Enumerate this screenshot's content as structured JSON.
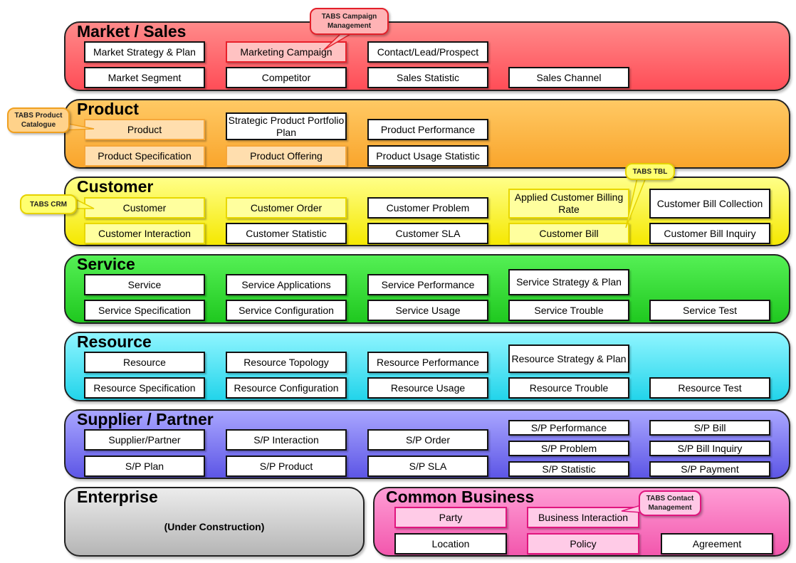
{
  "colors": {
    "market_sales": "#ff5b63",
    "product": "#fbb040",
    "customer": "#f8ef20",
    "service": "#2ed82e",
    "resource": "#3ddcef",
    "supplier_partner": "#736dee",
    "enterprise": "#cfcfcf",
    "common_business": "#f773bd"
  },
  "bands": {
    "market_sales": {
      "title": "Market / Sales",
      "entities": [
        "Market Strategy & Plan",
        "Marketing Campaign",
        "Contact/Lead/Prospect",
        "Market Segment",
        "Competitor",
        "Sales Statistic",
        "Sales Channel"
      ]
    },
    "product": {
      "title": "Product",
      "entities": [
        "Product",
        "Strategic Product Portfolio Plan",
        "Product Performance",
        "Product Specification",
        "Product Offering",
        "Product Usage Statistic"
      ]
    },
    "customer": {
      "title": "Customer",
      "entities": [
        "Customer",
        "Customer Order",
        "Customer Problem",
        "Applied Customer Billing Rate",
        "Customer Bill Collection",
        "Customer Interaction",
        "Customer Statistic",
        "Customer SLA",
        "Customer Bill",
        "Customer Bill Inquiry"
      ]
    },
    "service": {
      "title": "Service",
      "entities": [
        "Service",
        "Service Applications",
        "Service Performance",
        "Service Strategy & Plan",
        "Service Specification",
        "Service Configuration",
        "Service Usage",
        "Service Trouble",
        "Service Test"
      ]
    },
    "resource": {
      "title": "Resource",
      "entities": [
        "Resource",
        "Resource Topology",
        "Resource Performance",
        "Resource Strategy & Plan",
        "Resource Specification",
        "Resource Configuration",
        "Resource Usage",
        "Resource Trouble",
        "Resource Test"
      ]
    },
    "supplier_partner": {
      "title": "Supplier / Partner",
      "entities": [
        "Supplier/Partner",
        "S/P Interaction",
        "S/P Order",
        "S/P Performance",
        "S/P Bill",
        "S/P Problem",
        "S/P Bill Inquiry",
        "S/P Plan",
        "S/P Product",
        "S/P SLA",
        "S/P Statistic",
        "S/P Payment"
      ]
    },
    "enterprise": {
      "title": "Enterprise",
      "note": "(Under Construction)"
    },
    "common_business": {
      "title": "Common Business",
      "entities": [
        "Party",
        "Business Interaction",
        "Location",
        "Policy",
        "Agreement"
      ]
    }
  },
  "callouts": {
    "campaign": "TABS Campaign Management",
    "product_catalogue": "TABS Product Catalogue",
    "crm": "TABS CRM",
    "tbl": "TABS TBL",
    "contact": "TABS Contact Management"
  }
}
